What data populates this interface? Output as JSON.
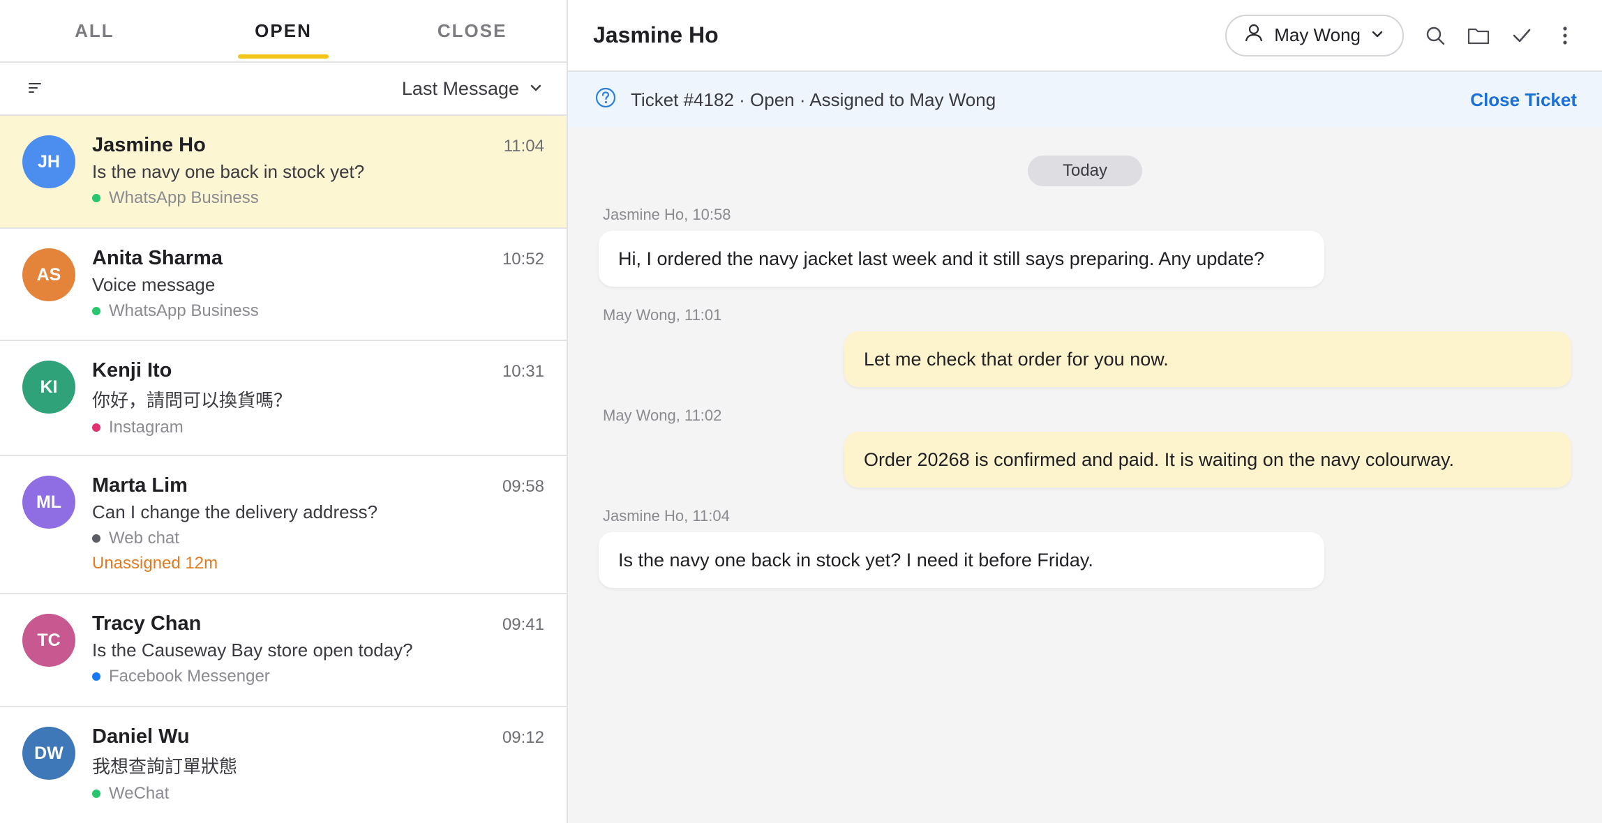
{
  "tabs": [
    {
      "label": "ALL"
    },
    {
      "label": "OPEN"
    },
    {
      "label": "CLOSE"
    }
  ],
  "sort": {
    "label": "Last Message"
  },
  "conversations": [
    {
      "initials": "JH",
      "name": "Jasmine Ho",
      "time": "11:04",
      "message": "Is the navy one back in stock yet?",
      "channel": "WhatsApp Business",
      "channel_color": "#28c76f",
      "avatar_color": "#4b8ef0",
      "selected": true
    },
    {
      "initials": "AS",
      "name": "Anita Sharma",
      "time": "10:52",
      "message": "Voice message",
      "channel": "WhatsApp Business",
      "channel_color": "#28c76f",
      "avatar_color": "#e4843a"
    },
    {
      "initials": "KI",
      "name": "Kenji Ito",
      "time": "10:31",
      "message": "你好，請問可以換貨嗎？",
      "channel": "Instagram",
      "channel_color": "#e0306f",
      "avatar_color": "#2fa27a"
    },
    {
      "initials": "ML",
      "name": "Marta Lim",
      "time": "09:58",
      "message": "Can I change the delivery address?",
      "channel": "Web chat",
      "channel_color": "#5c5c64",
      "avatar_color": "#8f6ee3",
      "warning": "Unassigned 12m"
    },
    {
      "initials": "TC",
      "name": "Tracy Chan",
      "time": "09:41",
      "message": "Is the Causeway Bay store open today?",
      "channel": "Facebook Messenger",
      "channel_color": "#1877f2",
      "avatar_color": "#c85890"
    },
    {
      "initials": "DW",
      "name": "Daniel Wu",
      "time": "09:12",
      "message": "我想查詢訂單狀態",
      "channel": "WeChat",
      "channel_color": "#28c76f",
      "avatar_color": "#3f78b8"
    }
  ],
  "header": {
    "title": "Jasmine Ho",
    "assignee": "May Wong"
  },
  "banner": {
    "text": "Ticket #4182 · Open · Assigned to May Wong",
    "action": "Close Ticket"
  },
  "chat": {
    "day_label": "Today",
    "messages": [
      {
        "meta": "Jasmine Ho, 10:58",
        "text": "Hi, I ordered the navy jacket last week and it still says preparing. Any update?",
        "direction": "in"
      },
      {
        "meta": "May Wong, 11:01",
        "text": "Let me check that order for you now.",
        "direction": "out"
      },
      {
        "meta": "May Wong, 11:02",
        "text": "Order 20268 is confirmed and paid. It is waiting on the navy colourway.",
        "direction": "out"
      },
      {
        "meta": "Jasmine Ho, 11:04",
        "text": "Is the navy one back in stock yet? I need it before Friday.",
        "direction": "in"
      }
    ]
  },
  "icons": {
    "filter": "filter-icon",
    "chevron": "chevron-down-icon",
    "user": "user-icon",
    "search": "search-icon",
    "folder": "folder-icon",
    "check": "check-icon",
    "more": "more-vertical-icon",
    "help": "help-circle-icon"
  }
}
